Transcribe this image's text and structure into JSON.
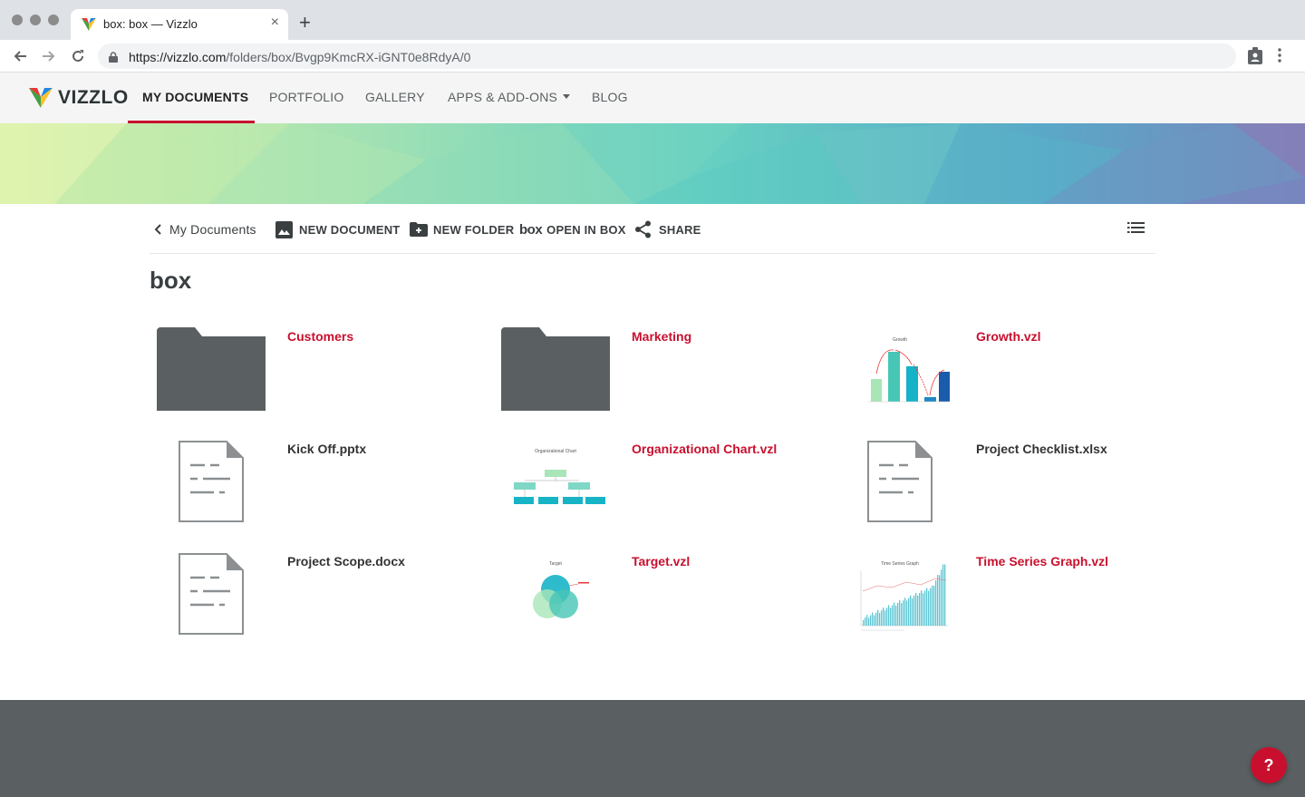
{
  "browser": {
    "tab_title": "box: box — Vizzlo",
    "close_glyph": "×",
    "new_tab_glyph": "+",
    "url_domain": "https://vizzlo.com",
    "url_path": "/folders/box/Bvgp9KmcRX-iGNT0e8RdyA/0"
  },
  "app": {
    "logo_text": "VIZZLO",
    "nav": [
      {
        "label": "MY DOCUMENTS",
        "active": true
      },
      {
        "label": "PORTFOLIO"
      },
      {
        "label": "GALLERY"
      },
      {
        "label": "APPS & ADD-ONS",
        "dropdown": true
      },
      {
        "label": "BLOG"
      }
    ],
    "accent_color": "#c8102e"
  },
  "toolbar": {
    "back_label": "My Documents",
    "new_document_label": "NEW DOCUMENT",
    "new_folder_label": "NEW FOLDER",
    "open_in_box_label": "OPEN IN BOX",
    "box_logo_text": "box",
    "share_label": "SHARE"
  },
  "folder": {
    "title": "box",
    "items": [
      {
        "name": "Customers",
        "kind": "folder"
      },
      {
        "name": "Marketing",
        "kind": "folder"
      },
      {
        "name": "Growth.vzl",
        "kind": "vizzlo"
      },
      {
        "name": "Kick Off.pptx",
        "kind": "file"
      },
      {
        "name": "Organizational Chart.vzl",
        "kind": "vizzlo"
      },
      {
        "name": "Project Checklist.xlsx",
        "kind": "file"
      },
      {
        "name": "Project Scope.docx",
        "kind": "file"
      },
      {
        "name": "Target.vzl",
        "kind": "vizzlo"
      },
      {
        "name": "Time Series Graph.vzl",
        "kind": "vizzlo"
      }
    ]
  },
  "thumbnails": {
    "growth_title": "Growth",
    "org_title": "Organizational Chart",
    "target_title": "Target",
    "timeseries_title": "Time Series Graph"
  },
  "help_label": "?"
}
